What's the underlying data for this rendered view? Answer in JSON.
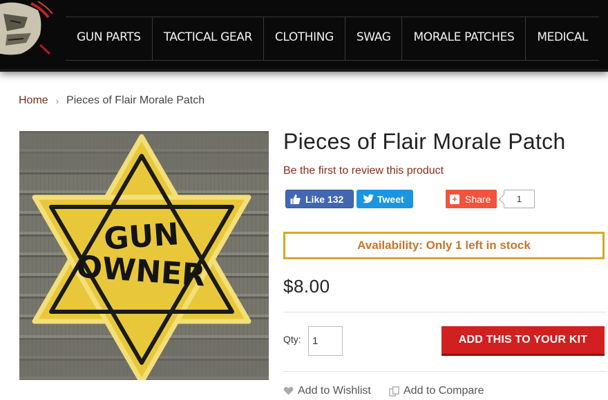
{
  "nav": {
    "items": [
      {
        "label": "GUN PARTS"
      },
      {
        "label": "TACTICAL GEAR"
      },
      {
        "label": "CLOTHING"
      },
      {
        "label": "SWAG"
      },
      {
        "label": "MORALE PATCHES"
      },
      {
        "label": "MEDICAL"
      }
    ]
  },
  "breadcrumb": {
    "home": "Home",
    "separator": "›",
    "current": "Pieces of Flair Morale Patch"
  },
  "product": {
    "title": "Pieces of Flair Morale Patch",
    "review_link": "Be the first to review this product",
    "image_text_line1": "GUN",
    "image_text_line2": "OWNER",
    "availability": "Availability: Only 1 left in stock",
    "price": "$8.00",
    "qty_label": "Qty:",
    "qty_value": "1",
    "add_button": "ADD THIS TO YOUR KIT",
    "wishlist": "Add to Wishlist",
    "compare": "Add to Compare"
  },
  "social": {
    "like_label": "Like",
    "like_count": "132",
    "tweet_label": "Tweet",
    "share_label": "Share",
    "share_count": "1"
  },
  "colors": {
    "header_bg": "#0a0a0a",
    "breadcrumb_link": "#7a2a1e",
    "availability_border": "#d9a62a",
    "availability_text": "#c8742a",
    "add_button": "#d21f1f",
    "facebook": "#4267b2",
    "twitter": "#1b95e0",
    "share": "#f0543c",
    "patch_yellow": "#e8c83a"
  }
}
